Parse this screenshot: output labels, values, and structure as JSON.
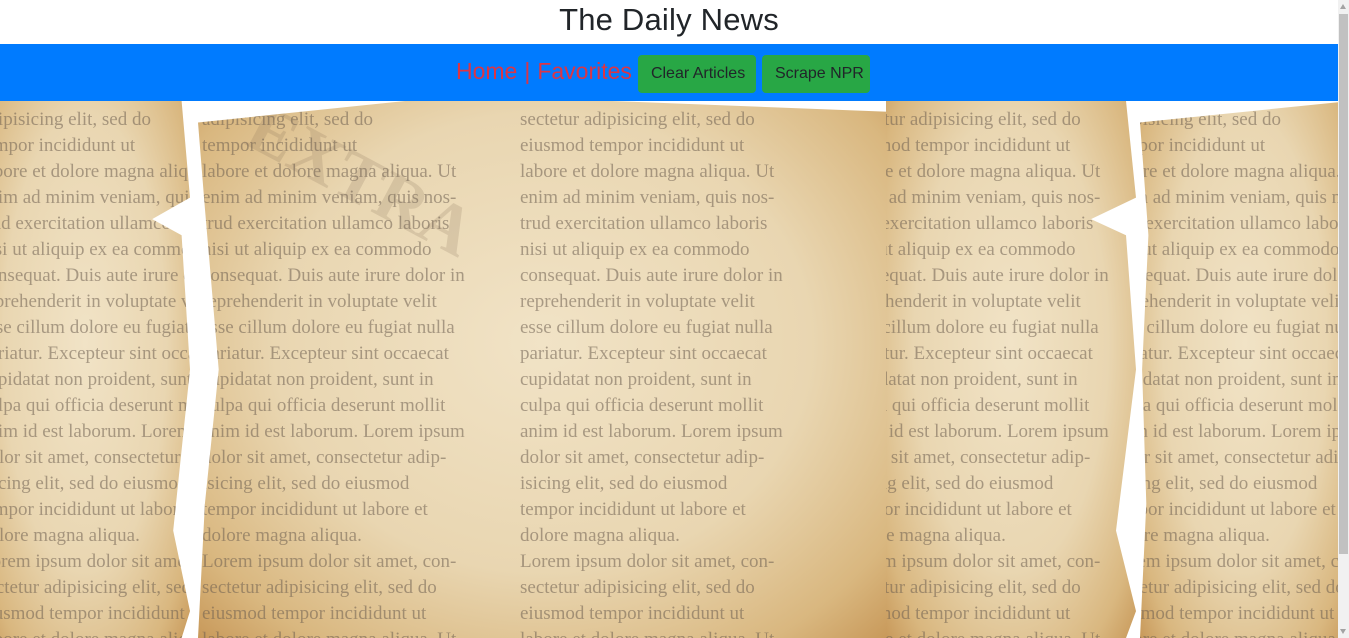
{
  "header": {
    "title": "The Daily News"
  },
  "nav": {
    "home_label": "Home",
    "separator": "|",
    "favorites_label": "Favorites",
    "clear_button": "Clear Articles",
    "scrape_button": "Scrape NPR"
  },
  "colors": {
    "nav_bg": "#007bff",
    "link": "#dc3545",
    "button_bg": "#28a745"
  },
  "background_text": {
    "col1": "adipisicing elit, sed do\ntempor incididunt ut\nlabore et dolore magna aliqua. Ut\nenim ad minim veniam, quis nos-\ntrud exercitation ullamco laboris\nnisi ut aliquip ex ea commodo\nconsequat. Duis aute irure dolor in\nreprehenderit in voluptate velit\nesse cillum dolore eu fugiat nulla\npariatur. Excepteur sint occaecat\ncupidatat non proident, sunt in\nculpa qui officia deserunt mollit\nanim id est laborum. Lorem ipsum\ndolor sit amet, consectetur adip-\nisicing elit, sed do eiusmod\ntempor incididunt ut labore et\ndolore magna aliqua.\nLorem ipsum dolor sit amet, con-\nsectetur adipisicing elit, sed do\neiusmod tempor incididunt ut\nlabore et dolore magna aliqua. Ut",
    "col2": "sectetur adipisicing elit, sed do\neiusmod tempor incididunt ut\nlabore et dolore magna aliqua. Ut\nenim ad minim veniam, quis nos-\ntrud exercitation ullamco laboris\nnisi ut aliquip ex ea commodo\nconsequat. Duis aute irure dolor in\nreprehenderit in voluptate velit\nesse cillum dolore eu fugiat nulla\npariatur. Excepteur sint occaecat\ncupidatat non proident, sunt in\nculpa qui officia deserunt mollit\nanim id est laborum. Lorem ipsum\ndolor sit amet, consectetur adip-\nisicing elit, sed do eiusmod\ntempor incididunt ut labore et\ndolore magna aliqua.\nLorem ipsum dolor sit amet, con-\nsectetur adipisicing elit, sed do\neiusmod tempor incididunt ut\nlabore et dolore magna aliqua. Ut"
  }
}
